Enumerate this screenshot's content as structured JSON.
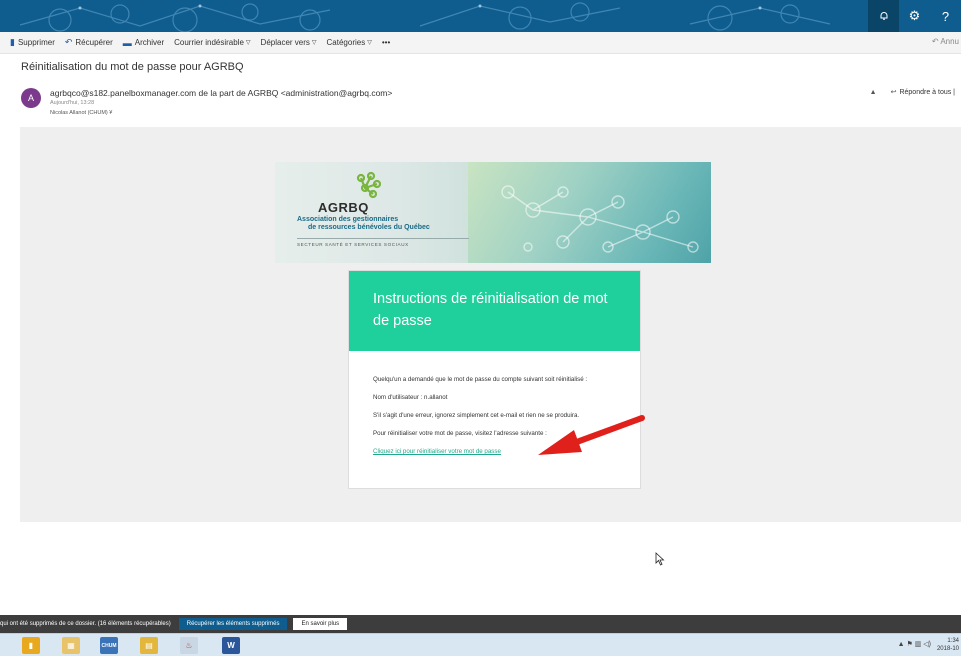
{
  "topbar": {
    "help_icon_text": "?"
  },
  "toolbar": {
    "delete": "Supprimer",
    "recover": "Récupérer",
    "archive": "Archiver",
    "junk": "Courrier indésirable",
    "move": "Déplacer vers",
    "categories": "Catégories",
    "more": "•••",
    "undo": "Annu"
  },
  "email": {
    "subject": "Réinitialisation du mot de passe pour AGRBQ",
    "avatar_initial": "A",
    "sender": "agrbqco@s182.panelboxmanager.com de la part de AGRBQ <administration@agrbq.com>",
    "date": "Aujourd'hui, 13:28",
    "recipient": "Nicolas Allanot (CHUM) ¥",
    "reply_all": "Répondre à tous |"
  },
  "banner": {
    "logo": "AGRBQ",
    "association_line1": "Association des gestionnaires",
    "association_line2": "de ressources bénévoles du Québec",
    "sector": "SECTEUR SANTÉ ET SERVICES SOCIAUX"
  },
  "card": {
    "title": "Instructions de réinitialisation de mot de passe",
    "line1": "Quelqu'un a demandé que le mot de passe du compte suivant soit réinitialisé :",
    "line2": "Nom d'utilisateur : n.allanot",
    "line3": "S'il s'agit d'une erreur, ignorez simplement cet e-mail et rien ne se produira.",
    "line4": "Pour réinitialiser votre mot de passe, visitez l'adresse suivante :",
    "link": "Cliquez ici pour réinitialiser votre mot de passe"
  },
  "notification": {
    "message": "qui ont été supprimés de ce dossier.  (16 éléments récupérables)",
    "recover_button": "Récupérer les éléments supprimés",
    "learn_more_button": "En savoir plus"
  },
  "taskbar": {
    "chum_label": "CHUM",
    "word_label": "W",
    "time": "1:34",
    "date": "2018-10"
  },
  "colors": {
    "topbar": "#0f5d8e",
    "card_header": "#1fcf9c",
    "link": "#1fa88b",
    "arrow": "#e0201b",
    "avatar": "#7b3a8c"
  }
}
